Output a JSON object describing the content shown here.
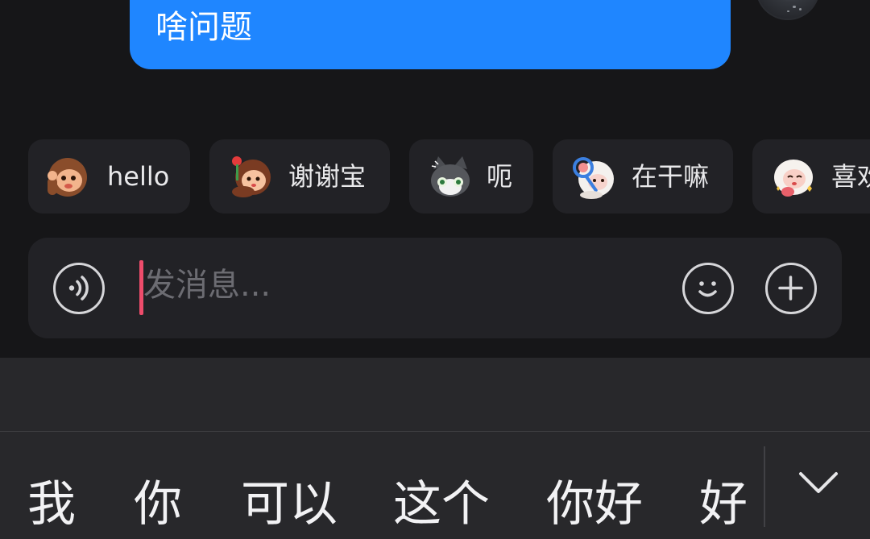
{
  "chat": {
    "message_text": "啥问题"
  },
  "quick_replies": [
    {
      "label": "hello",
      "sticker": "monkey-wave-sticker"
    },
    {
      "label": "谢谢宝",
      "sticker": "girl-with-rose-sticker"
    },
    {
      "label": "呃",
      "sticker": "cat-face-sticker"
    },
    {
      "label": "在干嘛",
      "sticker": "sheep-with-magnifier-sticker"
    },
    {
      "label": "喜欢",
      "sticker": "sheep-heart-sticker"
    }
  ],
  "input": {
    "placeholder": "发消息...",
    "voice_icon": "voice-wave-icon",
    "emoji_icon": "smiley-icon",
    "more_icon": "plus-icon"
  },
  "keyboard": {
    "candidates": [
      "我",
      "你",
      "可以",
      "这个",
      "你好",
      "好"
    ],
    "collapse_icon": "chevron-down-icon"
  },
  "colors": {
    "bubble": "#1f86ff",
    "background": "#161618",
    "chip": "#222226",
    "caret": "#ee4c6b",
    "keyboard": "#28282b"
  }
}
